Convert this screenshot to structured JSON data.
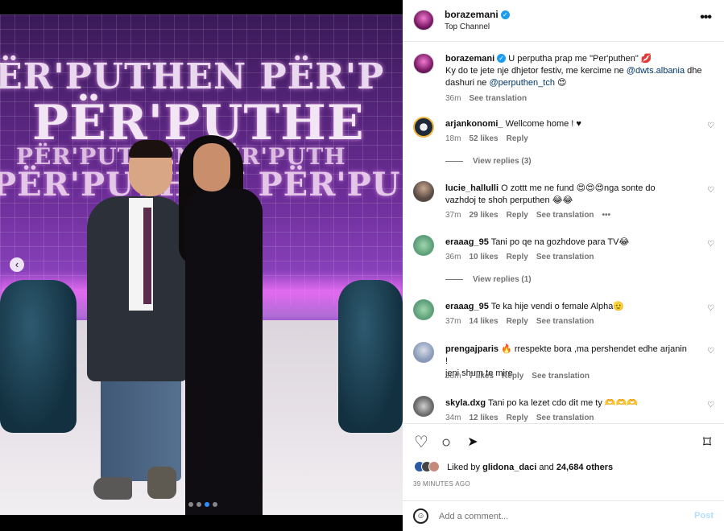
{
  "post": {
    "username": "borazemani",
    "location": "Top Channel",
    "more_icon": "•••",
    "caption": {
      "username": "borazemani",
      "line1": "U perputha prap me \"Per'puthen\" 💋",
      "line2_a": "Ky do te jete nje dhjetor festiv, me kercime ne ",
      "line2_mention": "@dwts.albania",
      "line2_b": " dhe",
      "line3_a": "dashuri ne ",
      "line3_mention": "@perputhen_tch",
      "line3_b": " 😍",
      "time": "36m",
      "see_translation": "See translation"
    }
  },
  "image": {
    "sign_1": "PËR'PUTHEN PËR'P",
    "sign_2": "PËR'PUTHE",
    "sign_3": "PËR'PUTHEN  PËR'PUTH",
    "sign_4": "PËR'PUTHEN PËR'PU",
    "prev_icon": "‹"
  },
  "comments": [
    {
      "user": "arjankonomi_",
      "text": "Wellcome home ! ♥",
      "time": "18m",
      "likes": "52 likes",
      "reply": "Reply",
      "translate": "",
      "more": "",
      "avatar_color": "#1e2a3a"
    },
    {
      "user": "lucie_hallulli",
      "text": "O zottt me ne fund 😍😍😍nga sonte do",
      "text2": "vazhdoj te shoh perputhen 😂😂",
      "time": "37m",
      "likes": "29 likes",
      "reply": "Reply",
      "translate": "See translation",
      "more": "•••",
      "avatar_color": "#5a4a44"
    },
    {
      "user": "eraaag_95",
      "text": "Tani po qe na gozhdove para TV😂",
      "time": "36m",
      "likes": "10 likes",
      "reply": "Reply",
      "translate": "See translation",
      "more": "",
      "avatar_color": "#5fa07a"
    },
    {
      "user": "eraaag_95",
      "text": "Te ka hije vendi o female Alpha🫡",
      "time": "37m",
      "likes": "14 likes",
      "reply": "Reply",
      "translate": "See translation",
      "more": "",
      "avatar_color": "#5fa07a"
    },
    {
      "user": "prengajparis",
      "text": "🔥 rrespekte bora ,ma pershendet edhe arjanin !",
      "text2": "jeni shum te mire",
      "time": "38m",
      "likes": "7 likes",
      "reply": "Reply",
      "translate": "See translation",
      "more": "",
      "avatar_color": "#8a9ab8"
    },
    {
      "user": "skyla.dxg",
      "text": "Tani po ka lezet cdo dit me ty 🫶🫶🫶",
      "time": "34m",
      "likes": "12 likes",
      "reply": "Reply",
      "translate": "See translation",
      "more": "",
      "avatar_color": "#6a6a6a"
    }
  ],
  "view_replies": [
    "View replies (3)",
    "View replies (1)"
  ],
  "actions": {
    "like_icon": "♡",
    "comment_icon": "○",
    "share_icon": "➤",
    "save_icon": "⌑",
    "liked_by_prefix": "Liked by ",
    "liked_by_user": "glidona_daci",
    "liked_by_and": " and ",
    "liked_by_count": "24,684 others",
    "time_ago": "39 MINUTES AGO"
  },
  "composer": {
    "emoji_icon": "☺",
    "placeholder": "Add a comment...",
    "post_label": "Post"
  },
  "colors": {
    "accent": "#0095f6",
    "verified": "#1d9bf0",
    "muted": "#737373"
  }
}
